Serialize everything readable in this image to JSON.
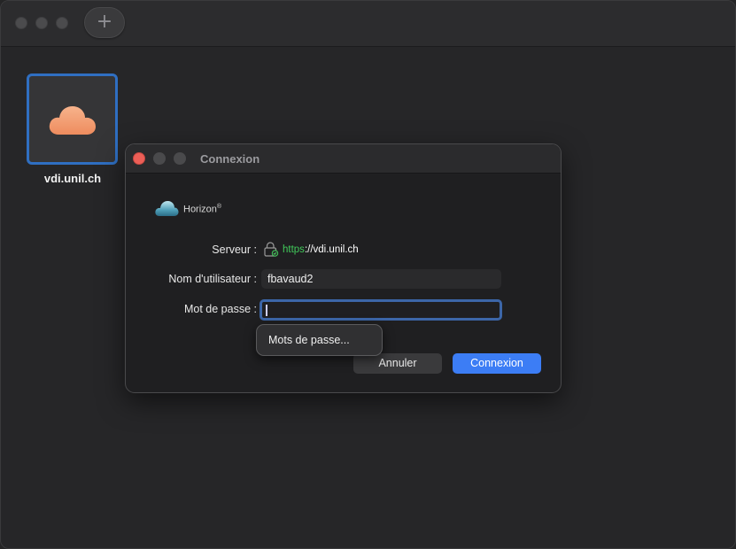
{
  "main_window": {
    "add_button_glyph": "+"
  },
  "server_tile": {
    "name": "vdi.unil.ch",
    "icon": "cloud-icon"
  },
  "dialog": {
    "title": "Connexion",
    "brand": {
      "name": "Horizon",
      "mark": "®",
      "icon": "horizon-logo-icon"
    },
    "server": {
      "label": "Serveur :",
      "scheme": "https",
      "rest": "://vdi.unil.ch",
      "icon": "lock-icon"
    },
    "username": {
      "label": "Nom d'utilisateur :",
      "value": "fbavaud2"
    },
    "password": {
      "label": "Mot de passe :",
      "value": ""
    },
    "autofill_popup": {
      "label": "Mots de passe..."
    },
    "buttons": {
      "cancel": "Annuler",
      "connect": "Connexion"
    },
    "colors": {
      "close": "#ec5f57",
      "https_green": "#41c95a",
      "primary": "#3c7df5",
      "focus_ring": "#3c66a8"
    }
  }
}
